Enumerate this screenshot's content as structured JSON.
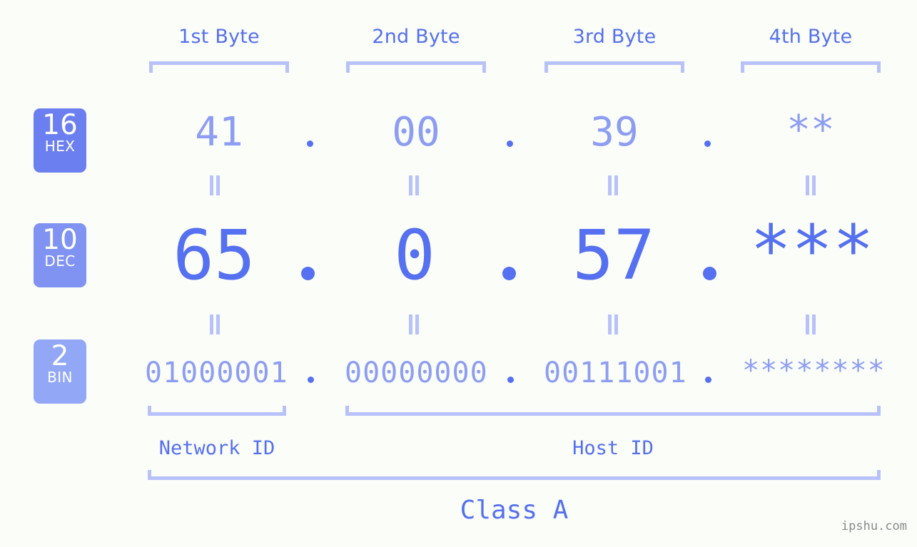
{
  "page": {
    "background_color": "#fbfdf9",
    "accent_color": "#5570f0",
    "light_accent_color": "#8d9df3",
    "bracket_color": "#b7c2fb",
    "watermark": "ipshu.com"
  },
  "headers": [
    {
      "label": "1st Byte"
    },
    {
      "label": "2nd Byte"
    },
    {
      "label": "3rd Byte"
    },
    {
      "label": "4th Byte"
    }
  ],
  "rows": [
    {
      "key": "hex",
      "badge": {
        "base": "16",
        "name": "HEX",
        "color": "#6c7ff0"
      },
      "values": [
        "41",
        "00",
        "39",
        "**"
      ],
      "separator": "."
    },
    {
      "key": "dec",
      "badge": {
        "base": "10",
        "name": "DEC",
        "color": "#8093f2"
      },
      "values": [
        "65",
        "0",
        "57",
        "***"
      ],
      "separator": "."
    },
    {
      "key": "bin",
      "badge": {
        "base": "2",
        "name": "BIN",
        "color": "#92a8f7"
      },
      "values": [
        "01000001",
        "00000000",
        "00111001",
        "********"
      ],
      "separator": "."
    }
  ],
  "equals_symbol": "=",
  "footer": {
    "network_id_label": "Network ID",
    "host_id_label": "Host ID",
    "class_label": "Class A"
  }
}
